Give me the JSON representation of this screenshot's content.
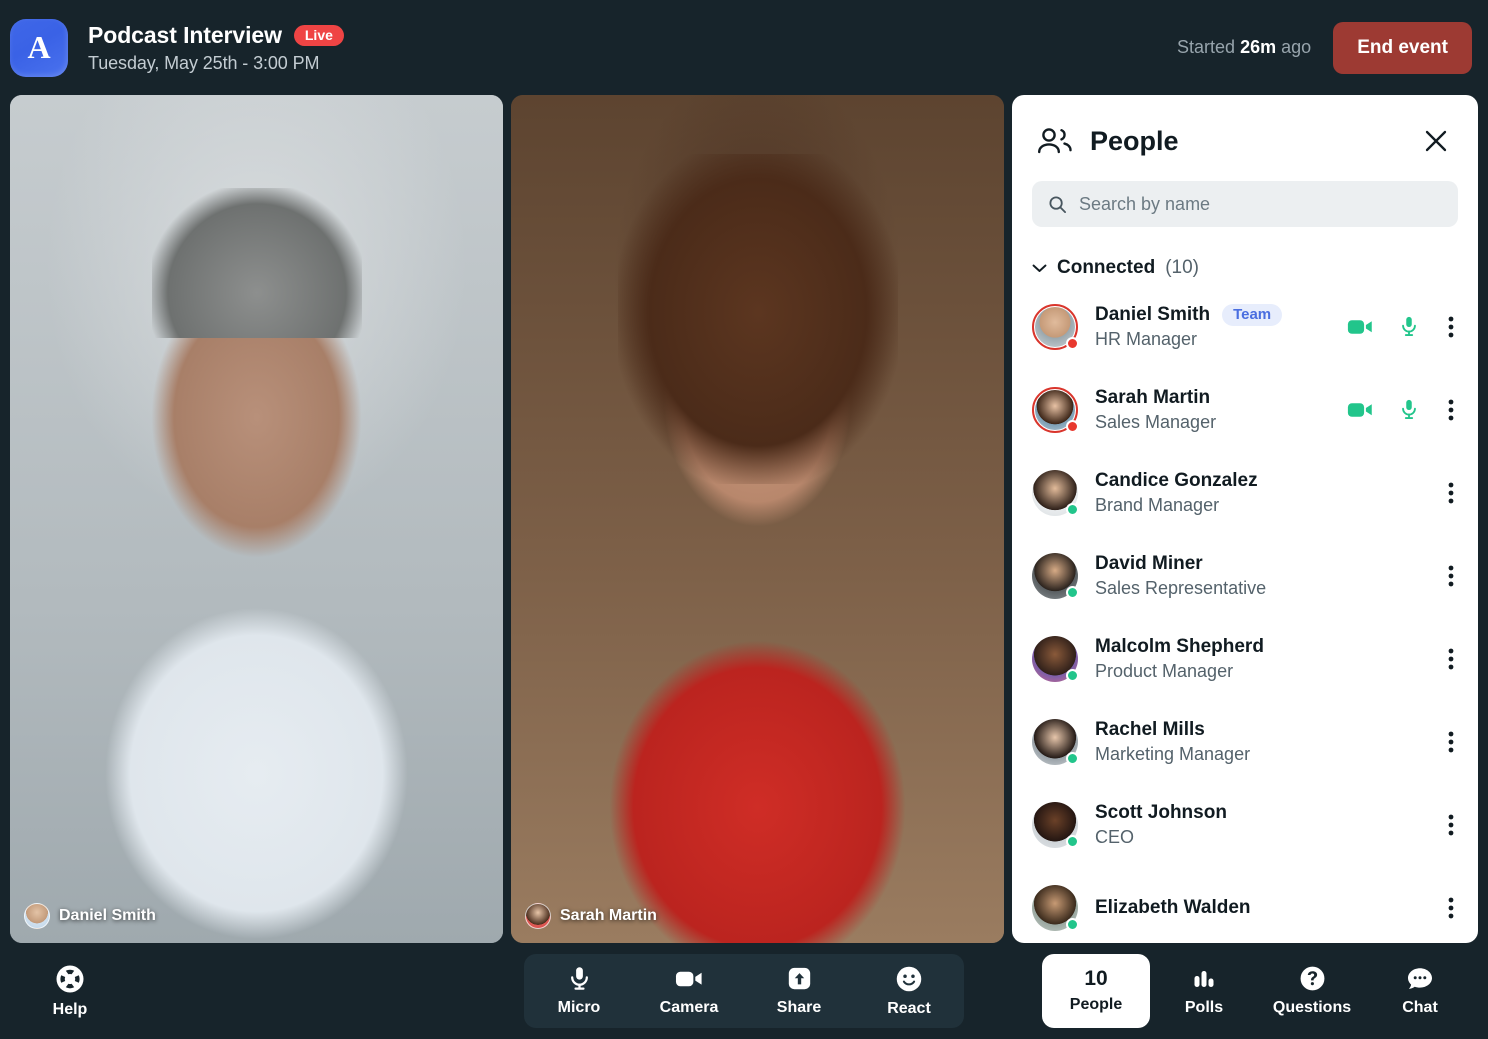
{
  "header": {
    "logo_letter": "A",
    "event_title": "Podcast Interview",
    "live_badge": "Live",
    "event_date": "Tuesday, May 25th - 3:00 PM",
    "started_prefix": "Started",
    "started_duration": "26m",
    "started_suffix": "ago",
    "end_event_label": "End event",
    "accent_red": "#9d3a33",
    "live_red": "#ef4444",
    "logo_blue": "#3f67e8"
  },
  "stage": {
    "tiles": [
      {
        "name": "Daniel Smith"
      },
      {
        "name": "Sarah Martin"
      }
    ]
  },
  "people_panel": {
    "title": "People",
    "close_label": "Close",
    "search": {
      "placeholder": "Search by name",
      "value": ""
    },
    "group": {
      "label": "Connected",
      "count": "(10)"
    },
    "people": [
      {
        "name": "Daniel Smith",
        "role": "HR Manager",
        "badge": "Team",
        "status": "red",
        "ring": true,
        "camera_on": true,
        "mic_on": true
      },
      {
        "name": "Sarah Martin",
        "role": "Sales Manager",
        "badge": "",
        "status": "red",
        "ring": true,
        "camera_on": true,
        "mic_on": true
      },
      {
        "name": "Candice Gonzalez",
        "role": "Brand Manager",
        "badge": "",
        "status": "green",
        "ring": false,
        "camera_on": false,
        "mic_on": false
      },
      {
        "name": "David Miner",
        "role": "Sales Representative",
        "badge": "",
        "status": "green",
        "ring": false,
        "camera_on": false,
        "mic_on": false
      },
      {
        "name": "Malcolm Shepherd",
        "role": "Product Manager",
        "badge": "",
        "status": "green",
        "ring": false,
        "camera_on": false,
        "mic_on": false
      },
      {
        "name": "Rachel Mills",
        "role": "Marketing Manager",
        "badge": "",
        "status": "green",
        "ring": false,
        "camera_on": false,
        "mic_on": false
      },
      {
        "name": "Scott Johnson",
        "role": "CEO",
        "badge": "",
        "status": "green",
        "ring": false,
        "camera_on": false,
        "mic_on": false
      },
      {
        "name": "Elizabeth Walden",
        "role": "",
        "badge": "",
        "status": "green",
        "ring": false,
        "camera_on": false,
        "mic_on": false
      }
    ],
    "icon_green": "#22c58b",
    "team_badge_bg": "#e7edfc",
    "team_badge_text": "#4a6ee0"
  },
  "footer": {
    "help_label": "Help",
    "controls": [
      {
        "label": "Micro",
        "icon": "microphone-icon"
      },
      {
        "label": "Camera",
        "icon": "video-camera-icon"
      },
      {
        "label": "Share",
        "icon": "share-upload-icon"
      },
      {
        "label": "React",
        "icon": "smiley-icon"
      }
    ],
    "panels": [
      {
        "label": "People",
        "count": "10",
        "icon": "",
        "active": true
      },
      {
        "label": "Polls",
        "count": "",
        "icon": "bar-chart-icon",
        "active": false
      },
      {
        "label": "Questions",
        "count": "",
        "icon": "question-mark-icon",
        "active": false
      },
      {
        "label": "Chat",
        "count": "",
        "icon": "chat-bubble-icon",
        "active": false
      }
    ]
  }
}
